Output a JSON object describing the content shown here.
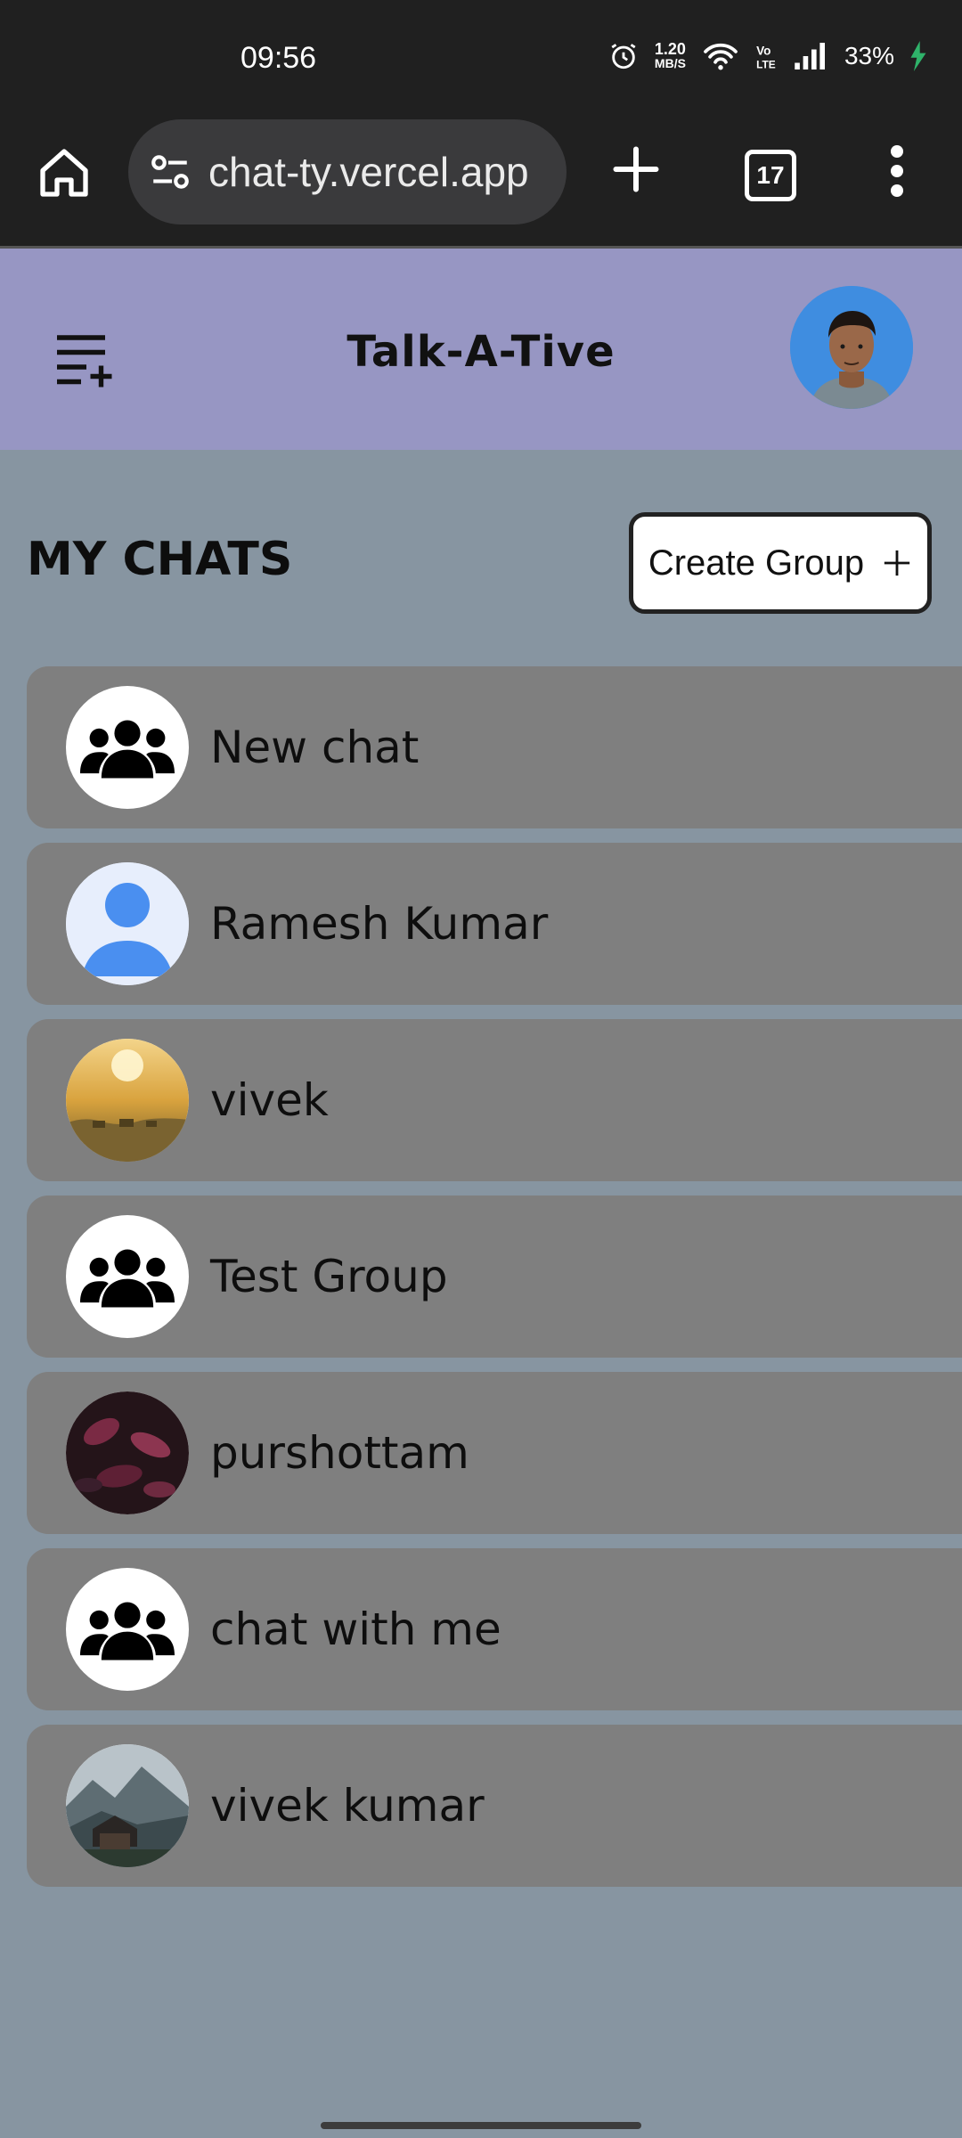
{
  "status_bar": {
    "time": "09:56",
    "speed_value": "1.20",
    "speed_unit": "MB/S",
    "battery": "33%",
    "icons": [
      "alarm-icon",
      "wifi-icon",
      "volte-icon",
      "signal-icon",
      "charging-icon"
    ]
  },
  "browser": {
    "url": "chat-ty.vercel.app",
    "tab_count": "17",
    "icons": [
      "home-icon",
      "site-settings-icon",
      "new-tab-icon",
      "tabs-icon",
      "more-icon"
    ]
  },
  "app": {
    "title": "Talk-A-Tive",
    "header_color": "#9796c3",
    "background_color": "#8795a1"
  },
  "chats": {
    "heading": "MY CHATS",
    "create_group_label": "Create Group",
    "create_group_icon": "plus",
    "items": [
      {
        "name": "New chat",
        "avatar": "group-icon"
      },
      {
        "name": "Ramesh Kumar",
        "avatar": "default-user-avatar"
      },
      {
        "name": "vivek",
        "avatar": "sunset-photo-avatar"
      },
      {
        "name": "Test Group",
        "avatar": "group-icon"
      },
      {
        "name": "purshottam",
        "avatar": "leaves-photo-avatar"
      },
      {
        "name": "chat with me",
        "avatar": "group-icon"
      },
      {
        "name": "vivek kumar",
        "avatar": "mountain-photo-avatar"
      }
    ]
  }
}
